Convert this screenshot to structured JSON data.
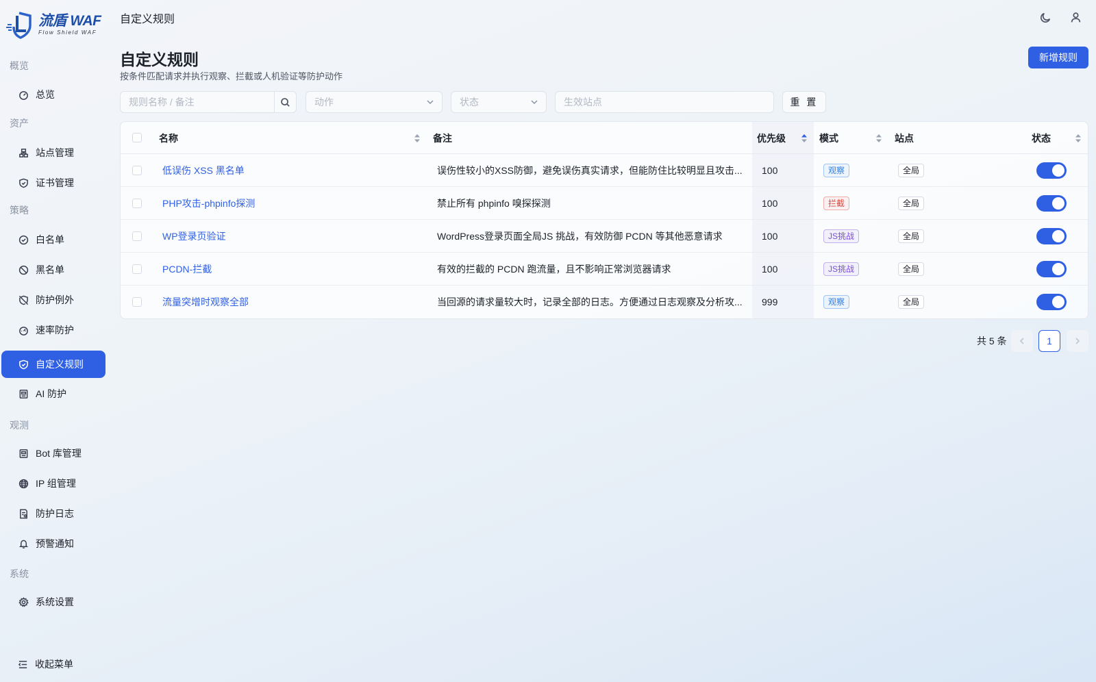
{
  "brand": {
    "name": "流盾 WAF",
    "tagline": "Flow Shield WAF",
    "accent": "#2f5fe3"
  },
  "sidebar": {
    "groups": [
      {
        "label": "概览"
      },
      {
        "label": "资产"
      },
      {
        "label": "策略"
      },
      {
        "label": "观测"
      },
      {
        "label": "系统"
      }
    ],
    "items": [
      {
        "label": "总览",
        "icon": "dashboard-icon"
      },
      {
        "label": "站点管理",
        "icon": "sitemap-icon"
      },
      {
        "label": "证书管理",
        "icon": "shield-check-icon"
      },
      {
        "label": "白名单",
        "icon": "check-circle-icon"
      },
      {
        "label": "黑名单",
        "icon": "ban-icon"
      },
      {
        "label": "防护例外",
        "icon": "shield-off-icon"
      },
      {
        "label": "速率防护",
        "icon": "gauge-icon"
      },
      {
        "label": "自定义规则",
        "icon": "shield-check-icon",
        "active": true
      },
      {
        "label": "AI 防护",
        "icon": "bot-icon"
      },
      {
        "label": "Bot 库管理",
        "icon": "bot-icon"
      },
      {
        "label": "IP 组管理",
        "icon": "globe-icon"
      },
      {
        "label": "防护日志",
        "icon": "log-icon"
      },
      {
        "label": "预警通知",
        "icon": "bell-icon"
      },
      {
        "label": "系统设置",
        "icon": "gear-icon"
      }
    ],
    "collapse_label": "收起菜单"
  },
  "header": {
    "breadcrumb": "自定义规则"
  },
  "page": {
    "title": "自定义规则",
    "subtitle": "按条件匹配请求并执行观察、拦截或人机验证等防护动作",
    "add_button": "新增规则"
  },
  "filters": {
    "search_placeholder": "规则名称 / 备注",
    "action_placeholder": "动作",
    "status_placeholder": "状态",
    "site_placeholder": "生效站点",
    "reset_label": "重 置"
  },
  "table": {
    "columns": {
      "name": "名称",
      "note": "备注",
      "priority": "优先级",
      "mode": "模式",
      "site": "站点",
      "status": "状态"
    },
    "rows": [
      {
        "name": "低误伤 XSS 黑名单",
        "note": "误伤性较小的XSS防御，避免误伤真实请求，但能防住比较明显且攻击...",
        "priority": "100",
        "mode": "观察",
        "mode_color": "#2f7fe3",
        "site": "全局",
        "enabled": true
      },
      {
        "name": "PHP攻击-phpinfo探测",
        "note": "禁止所有 phpinfo 嗅探探测",
        "priority": "100",
        "mode": "拦截",
        "mode_color": "#e0473d",
        "site": "全局",
        "enabled": true
      },
      {
        "name": "WP登录页验证",
        "note": "WordPress登录页面全局JS 挑战，有效防御 PCDN 等其他恶意请求",
        "priority": "100",
        "mode": "JS挑战",
        "mode_color": "#7a4fd6",
        "site": "全局",
        "enabled": true
      },
      {
        "name": "PCDN-拦截",
        "note": "有效的拦截的 PCDN 跑流量，且不影响正常浏览器请求",
        "priority": "100",
        "mode": "JS挑战",
        "mode_color": "#7a4fd6",
        "site": "全局",
        "enabled": true
      },
      {
        "name": "流量突增时观察全部",
        "note": "当回源的请求量较大时，记录全部的日志。方便通过日志观察及分析攻...",
        "priority": "999",
        "mode": "观察",
        "mode_color": "#2f7fe3",
        "site": "全局",
        "enabled": true
      }
    ]
  },
  "pagination": {
    "total": "共 5 条",
    "current": "1"
  }
}
